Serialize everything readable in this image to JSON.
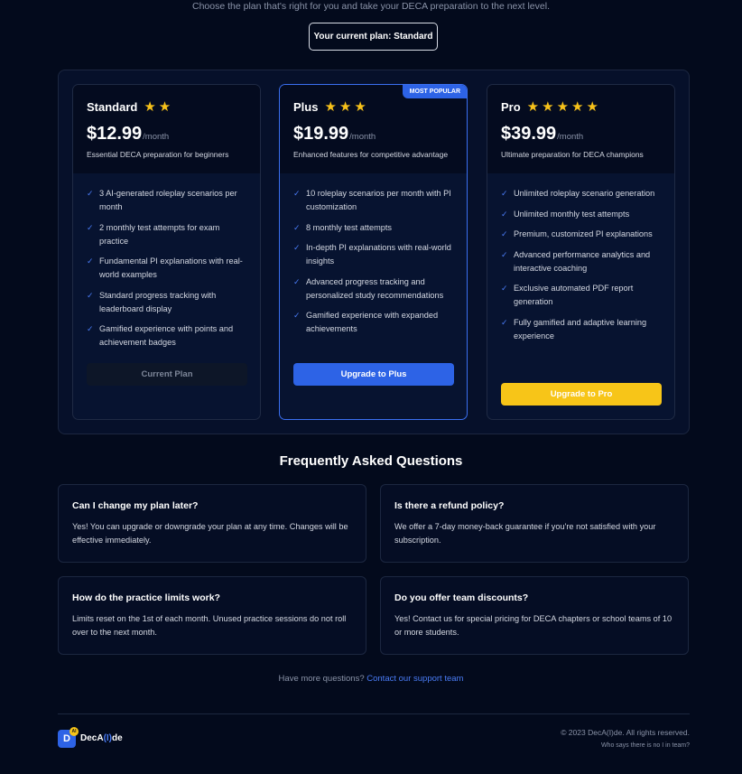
{
  "header": {
    "subtitle": "Choose the plan that's right for you and take your DECA preparation to the next level.",
    "current_plan_label": "Your current plan: Standard"
  },
  "plans": [
    {
      "name": "Standard",
      "stars": 2,
      "price": "$12.99",
      "period": "/month",
      "description": "Essential DECA preparation for beginners",
      "features": [
        "3 AI-generated roleplay scenarios per month",
        "2 monthly test attempts for exam practice",
        "Fundamental PI explanations with real-world examples",
        "Standard progress tracking with leaderboard display",
        "Gamified experience with points and achievement badges"
      ],
      "button": "Current Plan"
    },
    {
      "name": "Plus",
      "stars": 3,
      "price": "$19.99",
      "period": "/month",
      "description": "Enhanced features for competitive advantage",
      "badge": "MOST POPULAR",
      "features": [
        "10 roleplay scenarios per month with PI customization",
        "8 monthly test attempts",
        "In-depth PI explanations with real-world insights",
        "Advanced progress tracking and personalized study recommendations",
        "Gamified experience with expanded achievements"
      ],
      "button": "Upgrade to Plus"
    },
    {
      "name": "Pro",
      "stars": 5,
      "price": "$39.99",
      "period": "/month",
      "description": "Ultimate preparation for DECA champions",
      "features": [
        "Unlimited roleplay scenario generation",
        "Unlimited monthly test attempts",
        "Premium, customized PI explanations",
        "Advanced performance analytics and interactive coaching",
        "Exclusive automated PDF report generation",
        "Fully gamified and adaptive learning experience"
      ],
      "button": "Upgrade to Pro"
    }
  ],
  "faq": {
    "title": "Frequently Asked Questions",
    "items": [
      {
        "q": "Can I change my plan later?",
        "a": "Yes! You can upgrade or downgrade your plan at any time. Changes will be effective immediately."
      },
      {
        "q": "Is there a refund policy?",
        "a": "We offer a 7-day money-back guarantee if you're not satisfied with your subscription."
      },
      {
        "q": "How do the practice limits work?",
        "a": "Limits reset on the 1st of each month. Unused practice sessions do not roll over to the next month."
      },
      {
        "q": "Do you offer team discounts?",
        "a": "Yes! Contact us for special pricing for DECA chapters or school teams of 10 or more students."
      }
    ]
  },
  "support": {
    "prefix": "Have more questions?",
    "link": "Contact our support team"
  },
  "footer": {
    "logo_letter": "D",
    "logo_badge": "AI",
    "brand_prefix": "DecA",
    "brand_mid": "(I)",
    "brand_suffix": "de",
    "copyright": "© 2023 DecA(I)de. All rights reserved.",
    "tagline": "Who says there is no I in team?"
  },
  "colors": {
    "background": "#030a1c",
    "accent_blue": "#2d63e6",
    "accent_yellow": "#f7c518",
    "star": "#f6c11a"
  },
  "icons": {
    "star": "star-icon",
    "check": "check-icon"
  }
}
